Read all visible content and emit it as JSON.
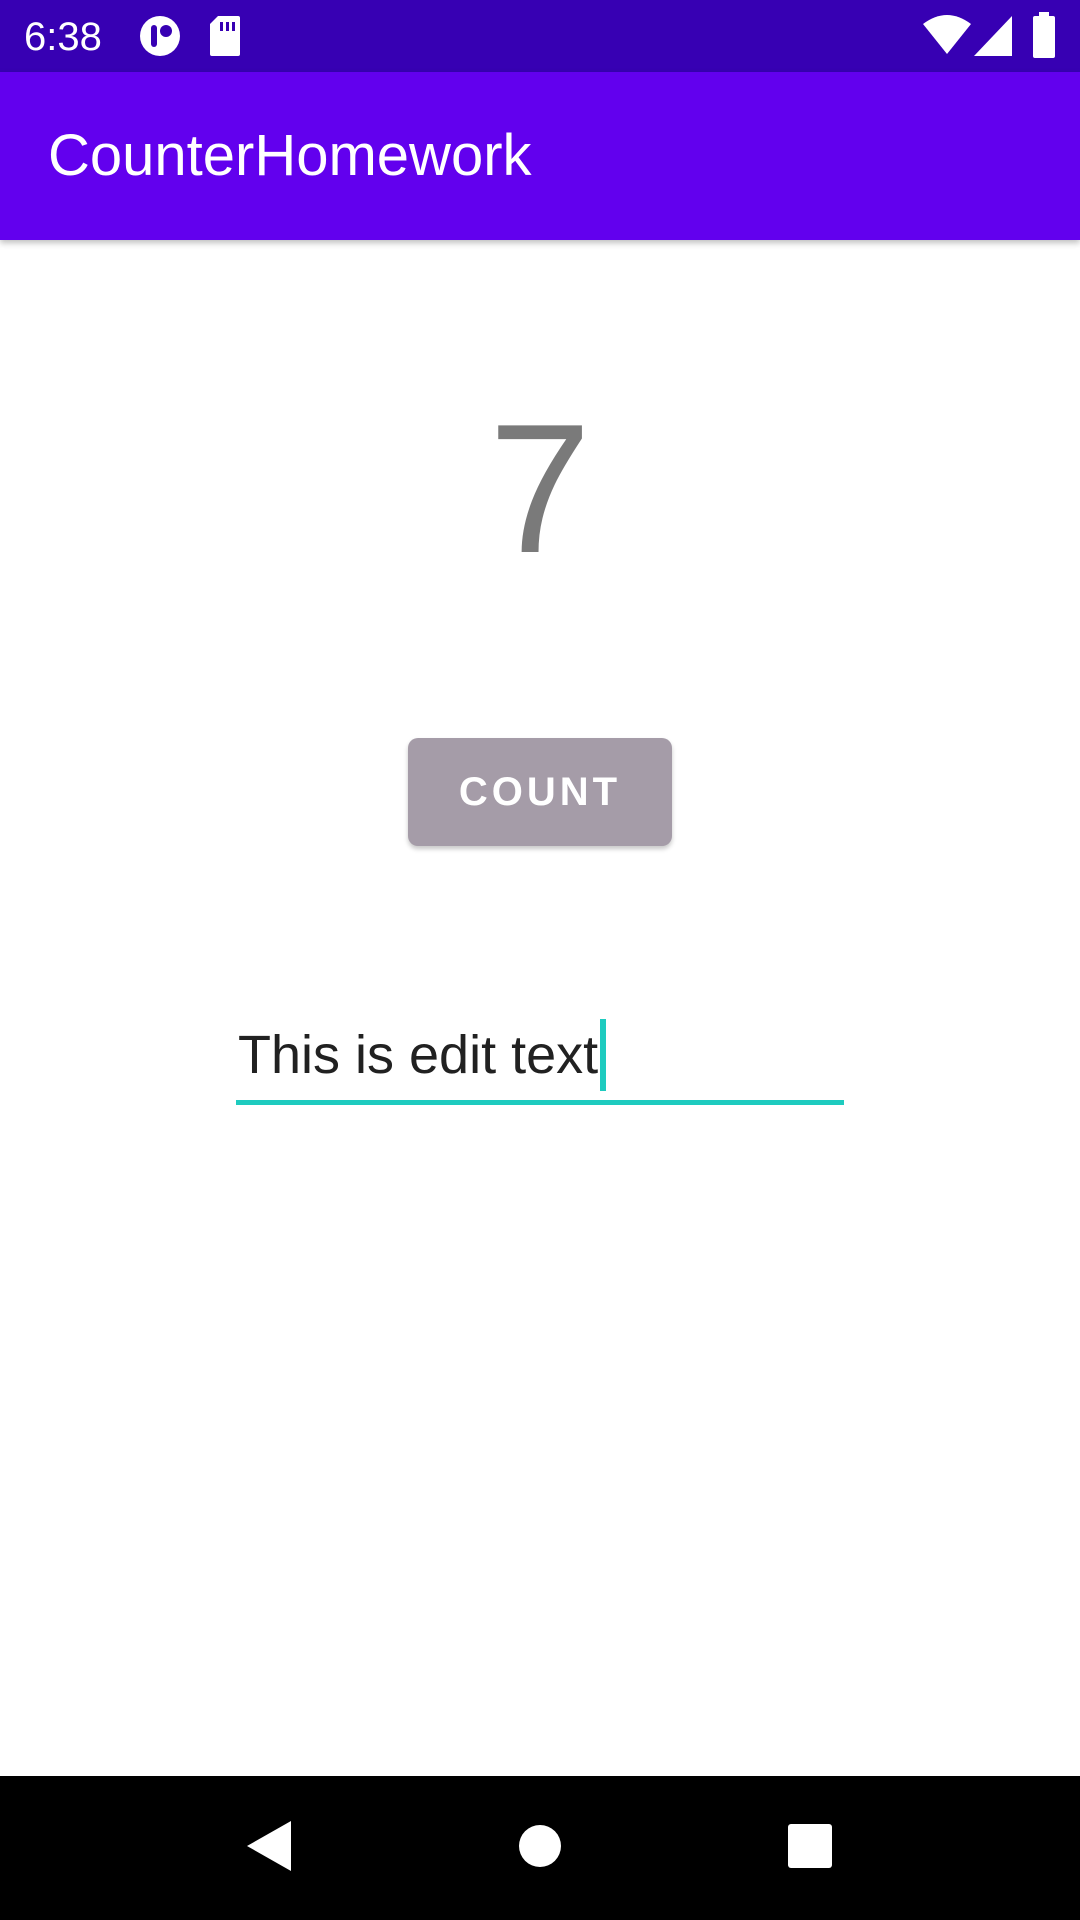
{
  "status_bar": {
    "time": "6:38",
    "left_icons": [
      "notification-app-icon",
      "sd-card-icon"
    ],
    "right_icons": [
      "wifi-icon",
      "cell-signal-icon",
      "battery-icon"
    ],
    "background_color": "#3700B3"
  },
  "app_bar": {
    "title": "CounterHomework",
    "background_color": "#6200EE"
  },
  "main": {
    "count_value": "7",
    "count_button_label": "COUNT",
    "count_button_color": "#A59CA8",
    "edit_text_value": "This is edit text",
    "edit_underline_color": "#1ECBBF"
  },
  "nav_bar": {
    "buttons": [
      "back-icon",
      "home-icon",
      "recents-icon"
    ]
  }
}
